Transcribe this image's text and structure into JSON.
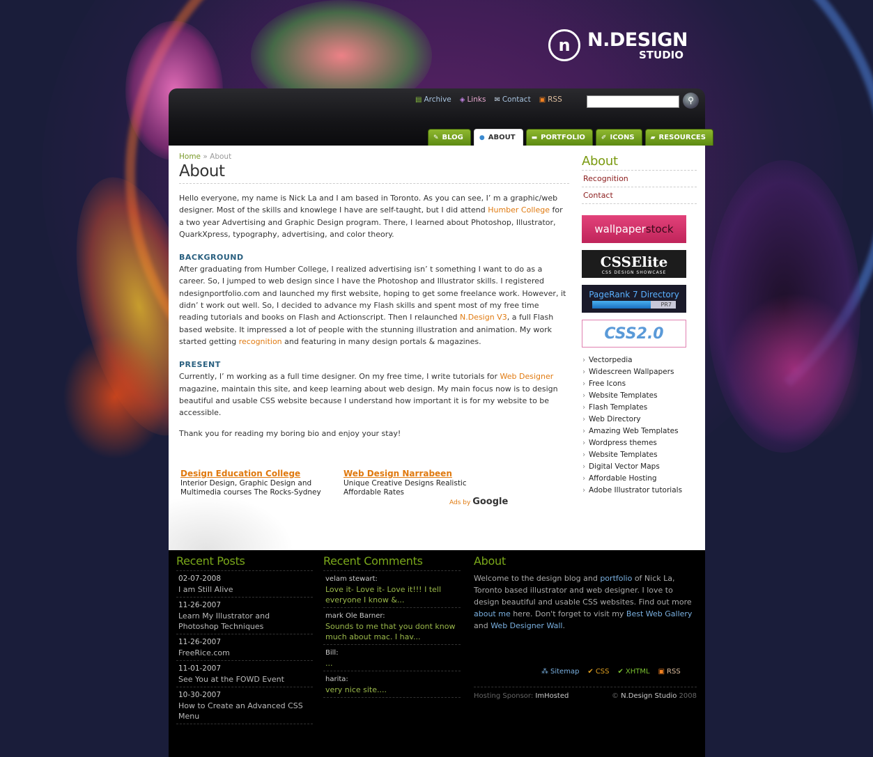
{
  "brand": {
    "logo_mark": "n",
    "name": "N.DESIGN",
    "sub": "STUDIO"
  },
  "toplinks": [
    {
      "label": "Archive",
      "icon": "archive-icon"
    },
    {
      "label": "Links",
      "icon": "links-icon"
    },
    {
      "label": "Contact",
      "icon": "mail-icon"
    },
    {
      "label": "RSS",
      "icon": "rss-icon"
    }
  ],
  "search": {
    "value": "",
    "placeholder": ""
  },
  "nav": [
    {
      "label": "BLOG",
      "icon": "pencil-icon"
    },
    {
      "label": "ABOUT",
      "icon": "drop-icon",
      "active": true
    },
    {
      "label": "PORTFOLIO",
      "icon": "folder-icon"
    },
    {
      "label": "ICONS",
      "icon": "brush-icon"
    },
    {
      "label": "RESOURCES",
      "icon": "box-icon"
    }
  ],
  "breadcrumb": {
    "home": "Home",
    "sep": "»",
    "current": "About"
  },
  "page_title": "About",
  "intro": {
    "a": "Hello everyone, my name is Nick La and I am based in Toronto. As you can see, I’ m a graphic/web designer. Most of the skills and knowlege I have are self-taught, but I did attend ",
    "link": "Humber College",
    "b": " for a two year Advertising and Graphic Design program. There, I learned about Photoshop, Illustrator, QuarkXpress, typography, advertising, and color theory."
  },
  "background": {
    "heading": "BACKGROUND",
    "a": "After graduating from Humber College, I realized advertising isn’ t something I want to do as a career. So, I jumped to web design since I have the Photoshop and Illustrator skills. I registered ndesignportfolio.com and launched my first website, hoping to get some freelance work. However, it didn’ t work out well. So, I decided to advance my Flash skills and spent most of my free time reading tutorials and books on Flash and Actionscript. Then I relaunched ",
    "link1": "N.Design V3",
    "b": ", a full Flash based website. It impressed a lot of people with the stunning illustration and animation. My work started getting ",
    "link2": "recognition",
    "c": " and featuring in many design portals & magazines."
  },
  "present": {
    "heading": "PRESENT",
    "a": "Currently, I’ m working as a full time designer. On my free time, I write tutorials for ",
    "link": "Web Designer",
    "b": " magazine, maintain this site, and keep learning about web design. My main focus now is to design beautiful and usable CSS website because I understand how important it is for my website to be accessible."
  },
  "closing": "Thank you for reading my boring bio and enjoy your stay!",
  "ads": [
    {
      "title": "Design Education College",
      "desc": "Interior Design, Graphic Design and Multimedia courses The Rocks-Sydney"
    },
    {
      "title": "Web Design Narrabeen",
      "desc": "Unique Creative Designs Realistic Affordable Rates"
    }
  ],
  "ads_by": {
    "prefix": "Ads by",
    "brand": "Google"
  },
  "sidebar": {
    "title": "About",
    "links": [
      "Recognition",
      "Contact"
    ],
    "banners": {
      "wallpaper_a": "wallpaper",
      "wallpaper_b": "stock",
      "csselite": "CSSElite",
      "csselite_sub": "CSS DESIGN SHOWCASE",
      "pagerank": "PageRank 7 Directory",
      "pagerank_badge": "PR7",
      "pagerank_level": 0.7,
      "css20": "CSS2.0"
    },
    "list": [
      "Vectorpedia",
      "Widescreen Wallpapers",
      "Free Icons",
      "Website Templates",
      "Flash Templates",
      "Web Directory",
      "Amazing Web Templates",
      "Wordpress themes",
      "Website Templates",
      "Digital Vector Maps",
      "Affordable Hosting",
      "Adobe Illustrator tutorials"
    ]
  },
  "footer": {
    "recent_posts": {
      "title": "Recent Posts",
      "items": [
        {
          "date": "02-07-2008",
          "title": "I am Still Alive"
        },
        {
          "date": "11-26-2007",
          "title": "Learn My Illustrator and Photoshop Techniques"
        },
        {
          "date": "11-26-2007",
          "title": "FreeRice.com"
        },
        {
          "date": "11-01-2007",
          "title": "See You at the FOWD Event"
        },
        {
          "date": "10-30-2007",
          "title": "How to Create an Advanced CSS Menu"
        }
      ]
    },
    "recent_comments": {
      "title": "Recent Comments",
      "items": [
        {
          "who": "velam stewart:",
          "text": "Love it- Love it- Love it!!! I tell everyone I know &..."
        },
        {
          "who": "mark Ole Barner:",
          "text": "Sounds to me that you dont know much about mac. I hav..."
        },
        {
          "who": "Bill:",
          "text": "..."
        },
        {
          "who": "harita:",
          "text": "very nice site...."
        }
      ]
    },
    "about": {
      "title": "About",
      "a": "Welcome to the design blog and ",
      "link1": "portfolio",
      "b": " of Nick La, Toronto based illustrator and web designer. I love to design beautiful and usable CSS websites. Find out more ",
      "link2": "about me",
      "c": " here. Don't forget to visit my ",
      "link3": "Best Web Gallery",
      "d": " and ",
      "link4": "Web Designer Wall",
      "e": "."
    },
    "links": [
      {
        "label": "Sitemap",
        "icon": "sitemap-icon"
      },
      {
        "label": "CSS",
        "icon": "check-icon"
      },
      {
        "label": "XHTML",
        "icon": "check-icon"
      },
      {
        "label": "RSS",
        "icon": "rss-icon"
      }
    ],
    "hosting_label": "Hosting Sponsor:",
    "hosting_name": "ImHosted",
    "copy_prefix": "©",
    "copy_name": "N.Design Studio",
    "copy_year": "2008"
  }
}
